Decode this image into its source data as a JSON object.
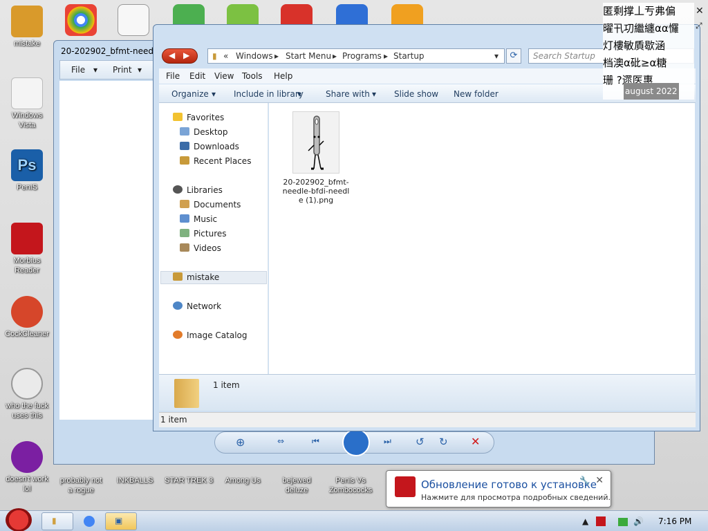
{
  "desktop_icons": [
    {
      "label": "mistake",
      "color": "#d99a2b"
    },
    {
      "label": "Windows\nVista",
      "color": "#f0f0f0"
    },
    {
      "label": "PenIS",
      "color": "#1a5fa8"
    },
    {
      "label": "Morbius\nReader",
      "color": "#c4161c"
    },
    {
      "label": "CockCleaner",
      "color": "#d6462a"
    },
    {
      "label": "who the fuck\nuses this",
      "color": "#eaeaea"
    },
    {
      "label": "doesn't work\nlol",
      "color": "#7b1fa2"
    }
  ],
  "bottom_icons": [
    "probably not\na rogue",
    "INKBALLS",
    "STAR TREK 3",
    "Among Us",
    "bejewed\ndeluze",
    "Penis Vs\nZombococks"
  ],
  "viewer": {
    "title": "20-202902_bfmt-needle",
    "file": "File",
    "print": "Print"
  },
  "explorer": {
    "breadcrumb": [
      "«",
      "Windows",
      "Start Menu",
      "Programs",
      "Startup"
    ],
    "search_placeholder": "Search Startup",
    "menu": [
      "File",
      "Edit",
      "View",
      "Tools",
      "Help"
    ],
    "toolbar": [
      "Organize",
      "Include in library",
      "Share with",
      "Slide show",
      "New folder"
    ],
    "nav": {
      "favorites": "Favorites",
      "desktop": "Desktop",
      "downloads": "Downloads",
      "recent": "Recent Places",
      "libraries": "Libraries",
      "documents": "Documents",
      "music": "Music",
      "pictures": "Pictures",
      "videos": "Videos",
      "mistake": "mistake",
      "network": "Network",
      "catalog": "Image Catalog"
    },
    "file_name": "20-202902_bfmt-needle-bfdi-needle (1).png",
    "details_count": "1 item",
    "status": "1 item"
  },
  "overlay": {
    "lines": [
      "匿剩撑丄亐弗偏",
      "曜卂㓛繼纏αα㦬",
      "灯樓敏貭歇涵",
      "档澳α砒≥α糖",
      "珊 ?遝医惠"
    ],
    "date": "august 2022"
  },
  "notification": {
    "title": "Обновление готово к установке",
    "message": "Нажмите для просмотра подробных сведений."
  },
  "taskbar": {
    "time": "7:16 PM"
  }
}
